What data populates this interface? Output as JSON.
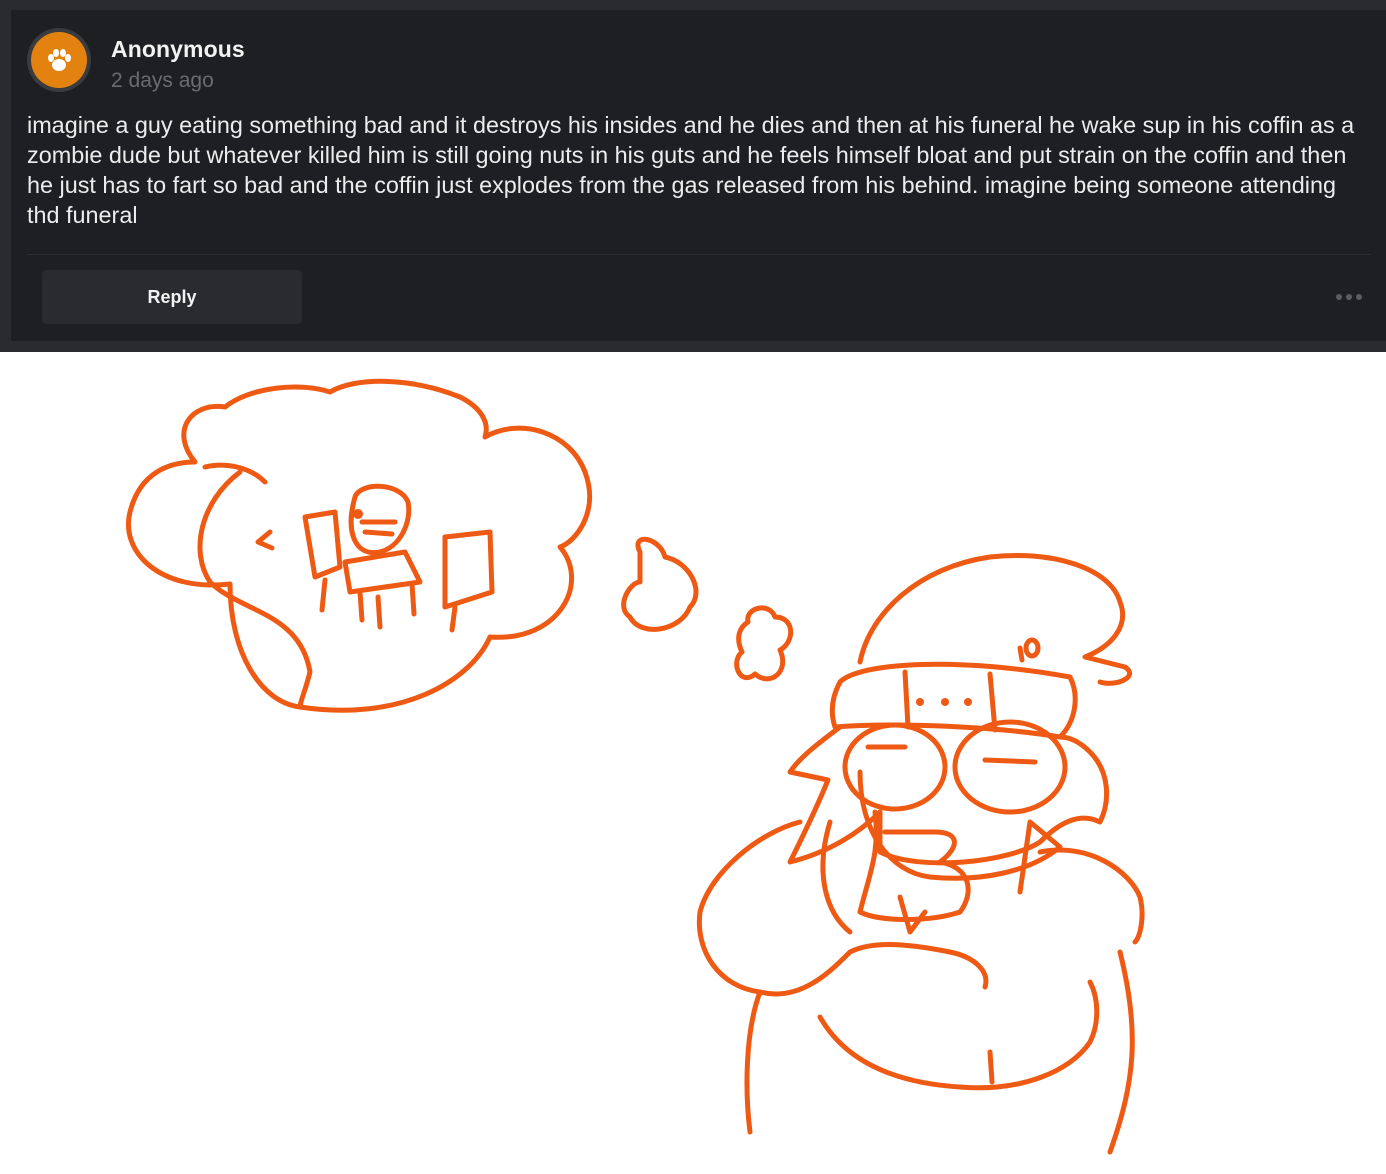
{
  "post": {
    "author": "Anonymous",
    "timestamp": "2 days ago",
    "avatar_icon": "paw-icon",
    "avatar_color": "#e3820f",
    "body": "imagine a guy eating something bad and it destroys his insides and he dies and then at his funeral he wake sup in his coffin as a zombie dude but whatever killed him is still going nuts in his guts and he feels himself bloat and put strain on the coffin and then he just has to fart so bad and the coffin just explodes from the gas released from his behind. imagine being someone attending thd funeral",
    "reply_label": "Reply",
    "more_icon": "more-options-icon"
  },
  "colors": {
    "card_bg": "#1e1f22",
    "band_bg": "#2a2b2e",
    "sketch_stroke": "#ee5a14"
  }
}
